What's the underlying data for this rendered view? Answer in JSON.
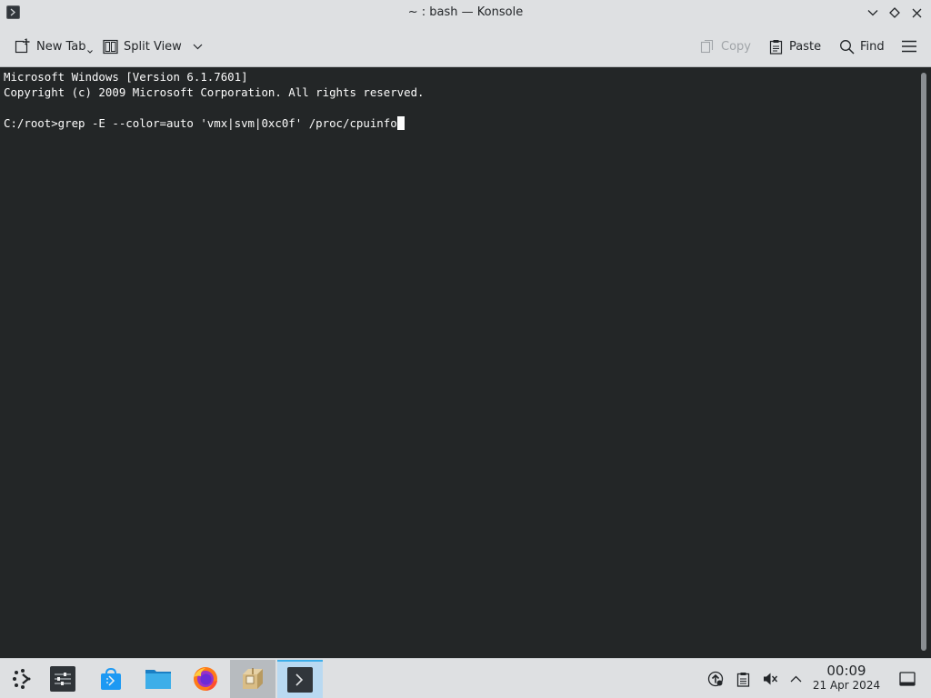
{
  "window": {
    "title": "~ : bash — Konsole",
    "icon": "terminal-icon",
    "controls": [
      "minimize-icon",
      "maximize-icon",
      "close-icon"
    ]
  },
  "toolbar": {
    "new_tab": "New Tab",
    "split_view": "Split View",
    "copy": "Copy",
    "paste": "Paste",
    "find": "Find",
    "menu_icon": "hamburger-menu-icon"
  },
  "terminal": {
    "lines": [
      "Microsoft Windows [Version 6.1.7601]",
      "Copyright (c) 2009 Microsoft Corporation. All rights reserved.",
      "",
      "C:/root>grep -E --color=auto 'vmx|svm|0xc0f' /proc/cpuinfo"
    ],
    "background": "#232627",
    "foreground": "#fcfcfc"
  },
  "taskbar": {
    "apps": [
      {
        "name": "application-launcher-icon"
      },
      {
        "name": "system-settings-icon"
      },
      {
        "name": "discover-store-icon"
      },
      {
        "name": "file-manager-icon"
      },
      {
        "name": "firefox-icon"
      },
      {
        "name": "archive-manager-icon"
      },
      {
        "name": "konsole-icon"
      }
    ],
    "tray_icons": [
      "updates-icon",
      "clipboard-icon",
      "volume-muted-icon",
      "show-hidden-icons-chevron"
    ],
    "clock": {
      "time": "00:09",
      "date": "21 Apr 2024"
    },
    "show_desktop_icon": "show-desktop-icon"
  },
  "colors": {
    "accent": "#3daee9",
    "panel": "#dee0e2"
  }
}
